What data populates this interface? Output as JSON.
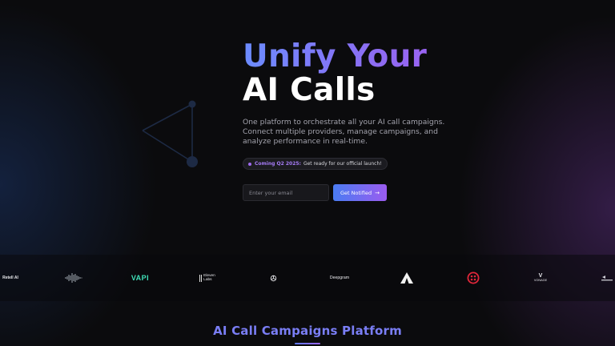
{
  "hero": {
    "headline_line1": "Unify Your",
    "headline_line2": "AI Calls",
    "description": "One platform to orchestrate all your AI call campaigns. Connect multiple providers, manage campaigns, and analyze performance in real-time.",
    "badge_highlight": "Coming Q2 2025:",
    "badge_text": "Get ready for our official launch!",
    "email_placeholder": "Enter your email",
    "email_value": "",
    "notify_label": "Get Notified",
    "notify_arrow": "→"
  },
  "providers": [
    {
      "name": "Retell AI"
    },
    {
      "name": "Soundwave"
    },
    {
      "name": "VAPI"
    },
    {
      "name": "Eleven Labs"
    },
    {
      "name": "OpenAI"
    },
    {
      "name": "Deepgram"
    },
    {
      "name": "Triangle"
    },
    {
      "name": "Twilio"
    },
    {
      "name": "VONAGE"
    },
    {
      "name": "Bland"
    }
  ],
  "logo_text": {
    "retell": "Retell AI",
    "vapi": "VAPI",
    "eleven_top": "Eleven",
    "eleven_bottom": "Labs",
    "deepgram": "Deepgram",
    "vonage": "VONAGE"
  },
  "section": {
    "title": "AI Call Campaigns Platform"
  },
  "colors": {
    "background": "#0b0b0d",
    "accent_blue": "#6b8cff",
    "accent_purple": "#a55cf2",
    "section_title": "#7a7ef5"
  }
}
